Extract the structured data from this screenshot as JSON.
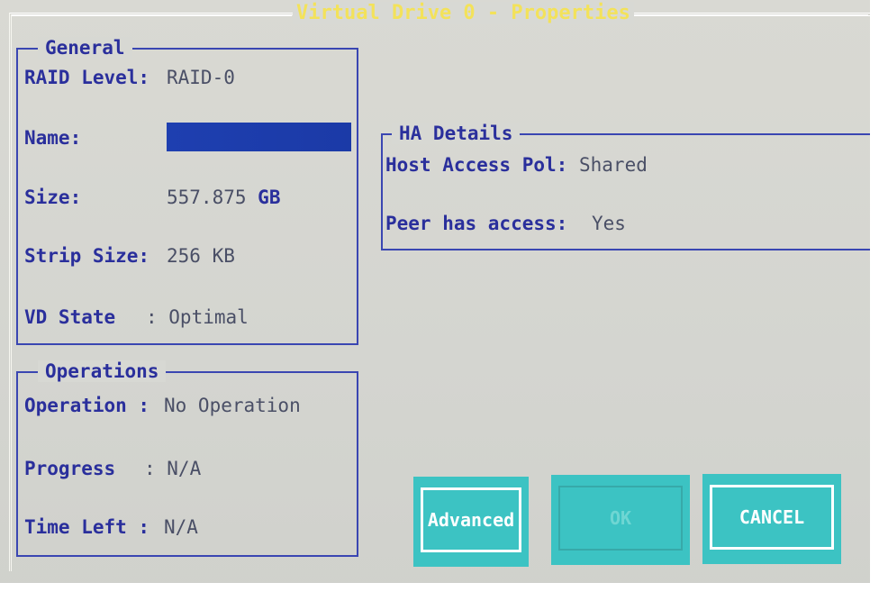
{
  "dialog": {
    "title": "Virtual Drive 0 - Properties"
  },
  "general": {
    "title": "General",
    "raid_level_label": "RAID Level:",
    "raid_level_value": "RAID-0",
    "name_label": "Name:",
    "name_value": "",
    "size_label": "Size:",
    "size_number": "557.875",
    "size_unit": "GB",
    "strip_size_label": "Strip Size:",
    "strip_size_value": "256 KB",
    "vd_state_label": "VD State",
    "vd_state_value": ": Optimal"
  },
  "ha_details": {
    "title": "HA Details",
    "host_access_label": "Host Access Pol:",
    "host_access_value": "Shared",
    "peer_access_label": "Peer has access:",
    "peer_access_value": "Yes"
  },
  "operations": {
    "title": "Operations",
    "operation_label": "Operation :",
    "operation_value": "No Operation",
    "progress_label": "Progress",
    "progress_value": ": N/A",
    "time_left_label": "Time Left :",
    "time_left_value": "N/A"
  },
  "buttons": {
    "advanced": "Advanced",
    "ok": "OK",
    "cancel": "CANCEL"
  },
  "colors": {
    "background": "#d6d7d2",
    "frame_blue": "#3a46b2",
    "label_blue": "#2a2f9c",
    "title_yellow": "#f3e25a",
    "input_blue": "#1e3fb0",
    "button_cyan": "#3cc3c3"
  }
}
